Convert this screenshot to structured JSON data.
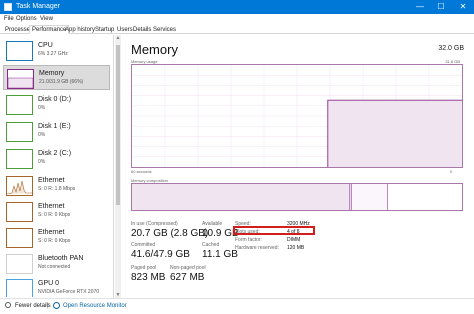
{
  "window": {
    "title": "Task Manager",
    "minimize": "—",
    "maximize": "☐",
    "close": "✕"
  },
  "menu": [
    "File",
    "Options",
    "View"
  ],
  "tabs": [
    "Processes",
    "Performance",
    "App history",
    "Startup",
    "Users",
    "Details",
    "Services"
  ],
  "active_tab": "Performance",
  "sidebar": {
    "items": [
      {
        "name": "CPU",
        "sub": "6%  3.27 GHz",
        "thumb": "cpu"
      },
      {
        "name": "Memory",
        "sub": "21.0/31.9 GB (66%)",
        "thumb": "mem",
        "selected": true
      },
      {
        "name": "Disk 0 (D:)",
        "sub": "0%",
        "thumb": "disk"
      },
      {
        "name": "Disk 1 (E:)",
        "sub": "0%",
        "thumb": "disk"
      },
      {
        "name": "Disk 2 (C:)",
        "sub": "0%",
        "thumb": "disk"
      },
      {
        "name": "Ethernet",
        "sub": "S: 0  R: 1.8 Mbps",
        "thumb": "eth"
      },
      {
        "name": "Ethernet",
        "sub": "S: 0  R: 0 Kbps",
        "thumb": "eth"
      },
      {
        "name": "Ethernet",
        "sub": "S: 0  R: 0 Kbps",
        "thumb": "eth"
      },
      {
        "name": "Bluetooth PAN",
        "sub": "Not connected",
        "thumb": "bt"
      },
      {
        "name": "GPU 0",
        "sub": "NVIDIA GeForce RTX 2070",
        "thumb": "gpu"
      }
    ]
  },
  "main": {
    "title": "Memory",
    "total": "32.0 GB",
    "graph_label": "Memory usage",
    "graph_max": "31.6 GB",
    "time_label": "60 seconds",
    "zero_label": "0",
    "composition_label": "Memory composition"
  },
  "stats": {
    "in_use_label": "In use (Compressed)",
    "in_use": "20.7 GB (2.8 GB)",
    "available_label": "Available",
    "available": "10.9 GB",
    "committed_label": "Committed",
    "committed": "41.6/47.9 GB",
    "cached_label": "Cached",
    "cached": "11.1 GB",
    "paged_label": "Paged pool",
    "paged": "823 MB",
    "nonpaged_label": "Non-paged pool",
    "nonpaged": "627 MB"
  },
  "specs": {
    "speed_label": "Speed:",
    "speed": "3200 MHz",
    "slots_label": "Slots used:",
    "slots": "4 of 8",
    "form_label": "Form factor:",
    "form": "DIMM",
    "reserved_label": "Hardware reserved:",
    "reserved": "120 MB"
  },
  "footer": {
    "fewer": "Fewer details",
    "separator": "|",
    "resmon": "Open Resource Monitor"
  },
  "colors": {
    "titlebar": "#0078d7",
    "memory": "#8b2a8b",
    "memory_fill": "#f1e4f1",
    "highlight": "#d21d1d"
  },
  "chart_data": {
    "type": "area",
    "ylim": [
      0,
      31.6
    ],
    "x_window_seconds": 60,
    "series": [
      {
        "values": [
          0,
          0,
          0,
          0,
          0,
          0,
          0,
          0,
          0,
          0,
          0,
          0,
          0,
          0,
          0,
          0,
          0,
          0,
          0,
          0,
          0,
          0,
          0,
          0,
          0,
          0,
          0,
          0,
          0,
          0,
          0,
          0,
          0,
          0,
          0,
          20.7,
          20.7,
          20.7,
          20.7,
          20.7,
          20.7,
          20.7,
          20.7,
          20.7,
          20.7,
          20.7,
          20.7,
          20.7,
          20.7,
          20.7,
          20.7,
          20.7,
          20.7,
          20.7,
          20.7,
          20.7,
          20.7,
          20.7,
          20.7,
          20.7
        ]
      }
    ]
  }
}
